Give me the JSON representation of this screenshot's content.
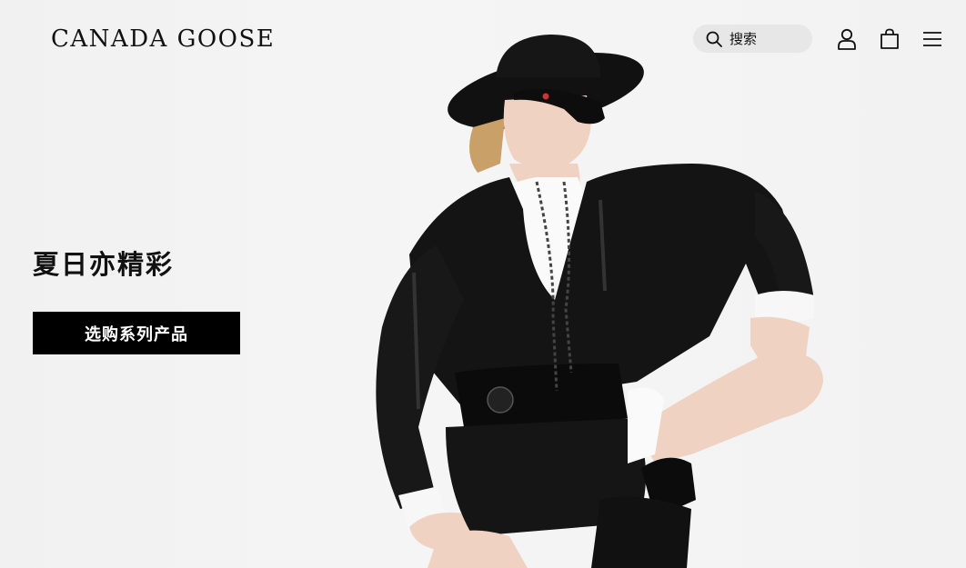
{
  "header": {
    "logo_text": "CANADA GOOSE",
    "search_placeholder": "搜索",
    "icons": [
      "search-icon",
      "account-icon",
      "bag-icon",
      "menu-icon"
    ]
  },
  "hero": {
    "headline": "夏日亦精彩",
    "cta_label": "选购系列产品"
  },
  "colors": {
    "background": "#f3f3f3",
    "text": "#111111",
    "cta_background": "#000000",
    "cta_text": "#ffffff",
    "search_background": "#e7e7e7"
  }
}
